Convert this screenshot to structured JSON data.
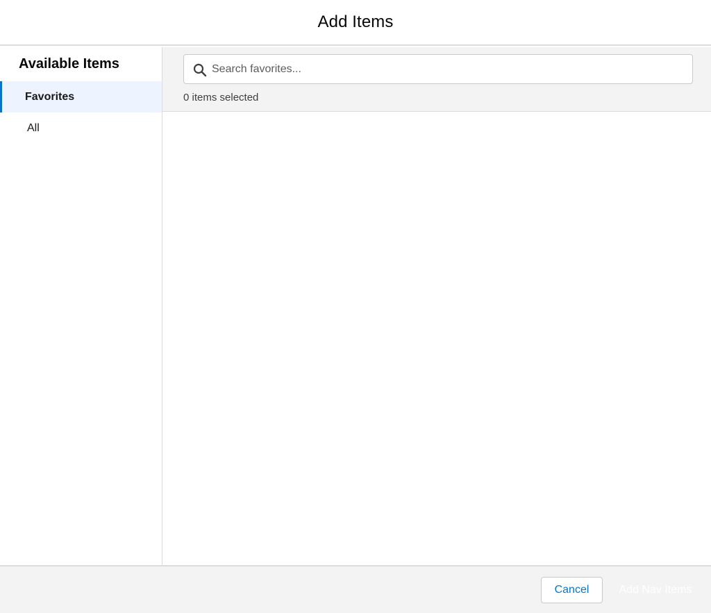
{
  "dialog": {
    "title": "Add Items"
  },
  "sidebar": {
    "heading": "Available Items",
    "items": [
      {
        "label": "Favorites",
        "active": true
      },
      {
        "label": "All",
        "active": false
      }
    ]
  },
  "search": {
    "placeholder": "Search favorites...",
    "value": "",
    "icon": "search-icon"
  },
  "selection": {
    "count_text": "0 items selected"
  },
  "footer": {
    "cancel_label": "Cancel",
    "add_label": "Add Nav Items"
  },
  "colors": {
    "accent": "#0176d3",
    "active_bg": "#eef4ff",
    "toolbar_bg": "#f3f3f3",
    "border": "#dddbda"
  }
}
